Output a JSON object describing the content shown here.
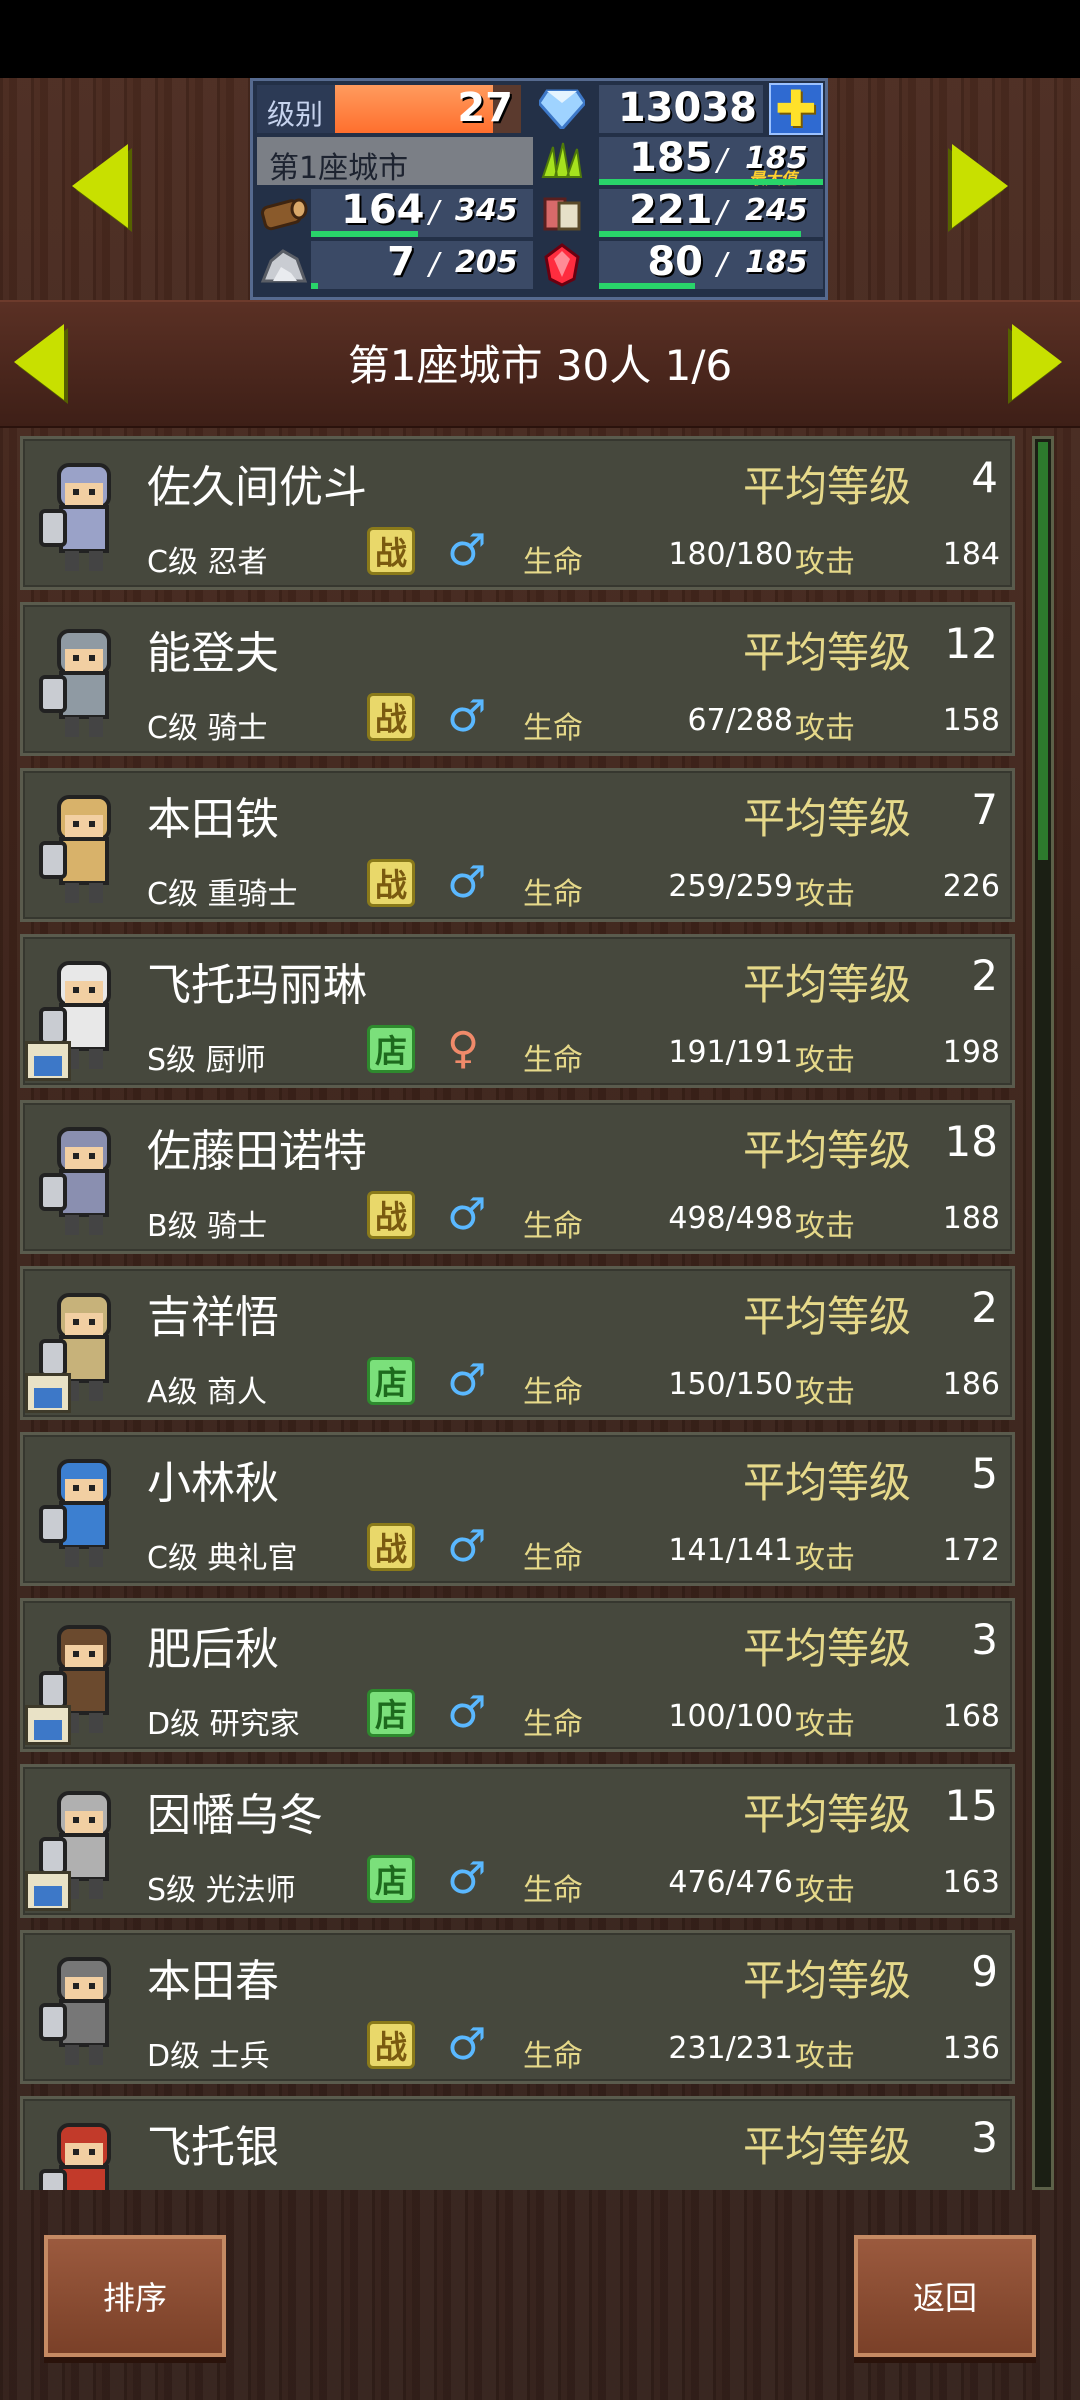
{
  "hud": {
    "level_label": "级别",
    "level_value": "27",
    "level_fill": 0.85,
    "gems": "13038",
    "city_name": "第1座城市",
    "food": {
      "cur": "185",
      "max": "185",
      "max_tag": "最大值",
      "fill": 1.0
    },
    "wood": {
      "cur": "164",
      "max": "345",
      "fill": 0.48
    },
    "cloth": {
      "cur": "221",
      "max": "245",
      "fill": 0.9
    },
    "stone": {
      "cur": "7",
      "max": "205",
      "fill": 0.03
    },
    "ruby": {
      "cur": "80",
      "max": "185",
      "fill": 0.43
    },
    "colors": {
      "accent": "#c8e000",
      "bar": "#29d46a",
      "level_bar": "#ff7a3d"
    }
  },
  "city_header": {
    "title": "第1座城市  30人 1/6"
  },
  "labels": {
    "avg_level": "平均等级",
    "hp": "生命",
    "atk": "攻击"
  },
  "characters": [
    {
      "name": "佐久间优斗",
      "level": "4",
      "class": "C级 忍者",
      "badge": "战",
      "badge_type": "battle",
      "gender": "male",
      "hp": "180/180",
      "atk": "184"
    },
    {
      "name": "能登夫",
      "level": "12",
      "class": "C级 骑士",
      "badge": "战",
      "badge_type": "battle",
      "gender": "male",
      "hp": "67/288",
      "atk": "158"
    },
    {
      "name": "本田铁",
      "level": "7",
      "class": "C级 重骑士",
      "badge": "战",
      "badge_type": "battle",
      "gender": "male",
      "hp": "259/259",
      "atk": "226"
    },
    {
      "name": "飞托玛丽琳",
      "level": "2",
      "class": "S级 厨师",
      "badge": "店",
      "badge_type": "shop",
      "gender": "female",
      "hp": "191/191",
      "atk": "198"
    },
    {
      "name": "佐藤田诺特",
      "level": "18",
      "class": "B级 骑士",
      "badge": "战",
      "badge_type": "battle",
      "gender": "male",
      "hp": "498/498",
      "atk": "188"
    },
    {
      "name": "吉祥悟",
      "level": "2",
      "class": "A级 商人",
      "badge": "店",
      "badge_type": "shop",
      "gender": "male",
      "hp": "150/150",
      "atk": "186"
    },
    {
      "name": "小林秋",
      "level": "5",
      "class": "C级 典礼官",
      "badge": "战",
      "badge_type": "battle",
      "gender": "male",
      "hp": "141/141",
      "atk": "172"
    },
    {
      "name": "肥后秋",
      "level": "3",
      "class": "D级 研究家",
      "badge": "店",
      "badge_type": "shop",
      "gender": "male",
      "hp": "100/100",
      "atk": "168"
    },
    {
      "name": "因幡乌冬",
      "level": "15",
      "class": "S级 光法师",
      "badge": "店",
      "badge_type": "shop",
      "gender": "male",
      "hp": "476/476",
      "atk": "163"
    },
    {
      "name": "本田春",
      "level": "9",
      "class": "D级 士兵",
      "badge": "战",
      "badge_type": "battle",
      "gender": "male",
      "hp": "231/231",
      "atk": "136"
    },
    {
      "name": "飞托银",
      "level": "3",
      "class": "",
      "badge": "",
      "badge_type": "battle",
      "gender": "male",
      "hp": "",
      "atk": ""
    }
  ],
  "scroll": {
    "position": 0.0,
    "visible_fraction": 0.24
  },
  "buttons": {
    "sort": "排序",
    "back": "返回"
  }
}
